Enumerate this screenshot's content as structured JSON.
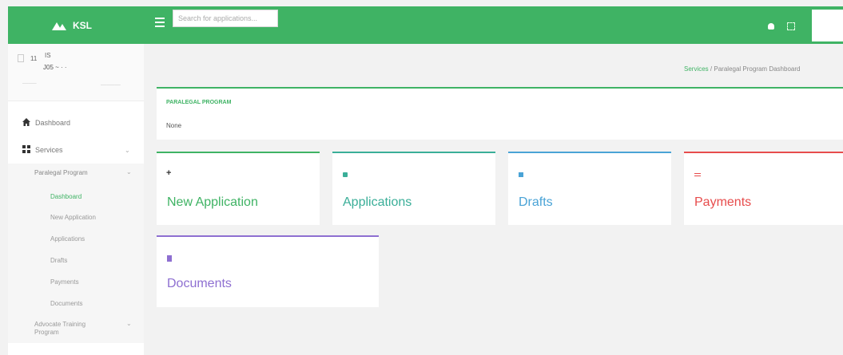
{
  "header": {
    "brand": "KSL",
    "search_placeholder": "Search for applications...",
    "color": "#3fb364"
  },
  "sidebar": {
    "profile": {
      "line1": "11",
      "line2": "IS",
      "line3": "J05 ~ · ·"
    },
    "items": [
      {
        "label": "Dashboard",
        "icon": "home-icon"
      },
      {
        "label": "Services",
        "icon": "grid-icon"
      }
    ],
    "services_sub": {
      "group_label": "Paralegal Program",
      "items": [
        "Dashboard",
        "New Application",
        "Applications",
        "Drafts",
        "Payments",
        "Documents"
      ]
    },
    "advocate": "Advocate Training Program"
  },
  "breadcrumb": {
    "link": "Services",
    "separator": "/",
    "current": "Paralegal Program Dashboard"
  },
  "program": {
    "title": "PARALEGAL PROGRAM",
    "value": "None"
  },
  "cards": [
    {
      "label": "New Application",
      "color": "#3fb364",
      "icon": "plus-icon"
    },
    {
      "label": "Applications",
      "color": "#3aae98",
      "icon": "folder-icon"
    },
    {
      "label": "Drafts",
      "color": "#4aa3d6",
      "icon": "draft-icon"
    },
    {
      "label": "Payments",
      "color": "#e74c4c",
      "icon": "credit-card-icon"
    },
    {
      "label": "Documents",
      "color": "#8e6fd1",
      "icon": "document-icon"
    }
  ]
}
